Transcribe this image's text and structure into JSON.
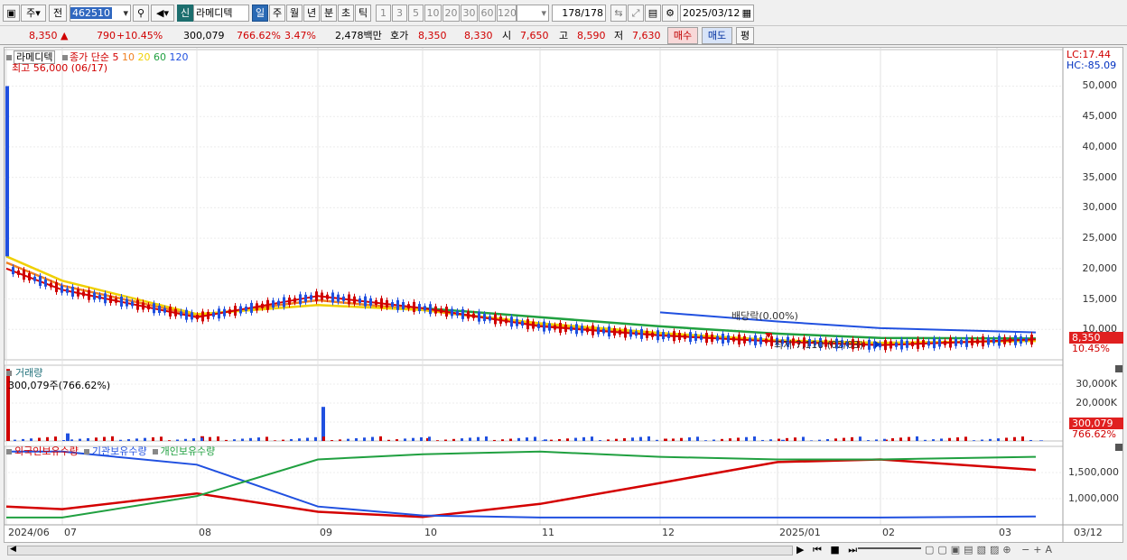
{
  "toolbar": {
    "mode": "주",
    "prev_label": "전",
    "code": "462510",
    "market_badge": "신",
    "stock_name": "라메디텍",
    "periods": [
      "일",
      "주",
      "월",
      "년",
      "분",
      "초",
      "틱"
    ],
    "selected_period": "일",
    "intervals": [
      "1",
      "3",
      "5",
      "10",
      "20",
      "30",
      "60",
      "120"
    ],
    "count_current": "178",
    "count_total": "/178",
    "date": "2025/03/12"
  },
  "quote": {
    "price": "8,350",
    "arrow": "▲",
    "change": "790",
    "change_pct": "+10.45%",
    "volume": "300,079",
    "vol_ratio": "766.62%",
    "turnover": "3.47%",
    "amount": "2,478백만",
    "hoga_label": "호가",
    "ask": "8,350",
    "bid": "8,330",
    "open_label": "시",
    "open": "7,650",
    "high_label": "고",
    "high": "8,590",
    "low_label": "저",
    "low": "7,630",
    "buy_label": "매수",
    "sell_label": "매도",
    "eval_label": "평"
  },
  "price_panel": {
    "stock_name": "라메디텍",
    "ma_label": "종가 단순",
    "ma_periods": [
      "5",
      "10",
      "20",
      "60",
      "120"
    ],
    "ma_colors": [
      "#d40000",
      "#f08020",
      "#f0d000",
      "#20a040",
      "#2050e0"
    ],
    "high_note": "최고 56,000 (06/17)",
    "low_note": "최저 7,110 (02/03)",
    "dividend_note": "배당락(0.00%)",
    "lc": "LC:17.44",
    "hc": "HC:-85.09",
    "last_price": "8,350",
    "last_pct": "10.45%",
    "y_ticks": [
      "50,000",
      "45,000",
      "40,000",
      "35,000",
      "30,000",
      "25,000",
      "20,000",
      "15,000",
      "10,000"
    ]
  },
  "volume_panel": {
    "title": "거래량",
    "note": "300,079주(766.62%)",
    "y_ticks": [
      "30,000K",
      "20,000K",
      "10,000K"
    ],
    "last": "300,079",
    "last_pct": "766.62%"
  },
  "holding_panel": {
    "series": [
      "외국인보유수량",
      "기관보유수량",
      "개인보유수량"
    ],
    "colors": [
      "#d40000",
      "#2050e0",
      "#20a040"
    ],
    "y_ticks": [
      "1,500,000",
      "1,000,000"
    ]
  },
  "x_axis": [
    "2024/06",
    "07",
    "08",
    "09",
    "10",
    "11",
    "12",
    "2025/01",
    "02",
    "03",
    "03/12"
  ],
  "chart_data": [
    {
      "type": "line",
      "title": "라메디텍",
      "x": [
        "2024/06",
        "07",
        "08",
        "09",
        "10",
        "11",
        "12",
        "2025/01",
        "02",
        "03"
      ],
      "series": [
        {
          "name": "5",
          "values": [
            20000,
            16500,
            12000,
            15500,
            13500,
            10500,
            9000,
            8000,
            7400,
            8350
          ]
        },
        {
          "name": "10",
          "values": [
            21000,
            17200,
            12300,
            14800,
            13200,
            10800,
            9200,
            8100,
            7600,
            8200
          ]
        },
        {
          "name": "20",
          "values": [
            22000,
            18000,
            12500,
            14000,
            13200,
            11000,
            9400,
            8200,
            7800,
            8100
          ]
        },
        {
          "name": "60",
          "values": [
            null,
            null,
            null,
            null,
            13500,
            12000,
            10500,
            9300,
            8600,
            8500
          ]
        },
        {
          "name": "120",
          "values": [
            null,
            null,
            null,
            null,
            null,
            null,
            12800,
            11300,
            10200,
            9500
          ]
        }
      ],
      "ylim": [
        5000,
        56000
      ],
      "annotations": [
        "최고 56,000 (06/17)",
        "최저 7,110 (02/03)",
        "배당락(0.00%)"
      ]
    },
    {
      "type": "bar",
      "title": "거래량",
      "categories": [
        "2024/06",
        "07",
        "08",
        "09",
        "10",
        "11",
        "12",
        "2025/01",
        "02",
        "03"
      ],
      "values": [
        38000,
        4000,
        2500,
        18000,
        1500,
        800,
        1200,
        600,
        700,
        300
      ],
      "ylim": [
        0,
        40000
      ]
    },
    {
      "type": "line",
      "series": [
        {
          "name": "외국인보유수량",
          "values": [
            850000,
            800000,
            1100000,
            750000,
            650000,
            900000,
            1300000,
            1700000,
            1750000,
            1550000
          ]
        },
        {
          "name": "기관보유수량",
          "values": [
            1900000,
            1900000,
            1650000,
            850000,
            680000,
            640000,
            640000,
            640000,
            640000,
            660000
          ]
        },
        {
          "name": "개인보유수량",
          "values": [
            640000,
            640000,
            1050000,
            1750000,
            1850000,
            1900000,
            1800000,
            1750000,
            1750000,
            1800000
          ]
        }
      ],
      "ylim": [
        500000,
        2000000
      ]
    }
  ]
}
